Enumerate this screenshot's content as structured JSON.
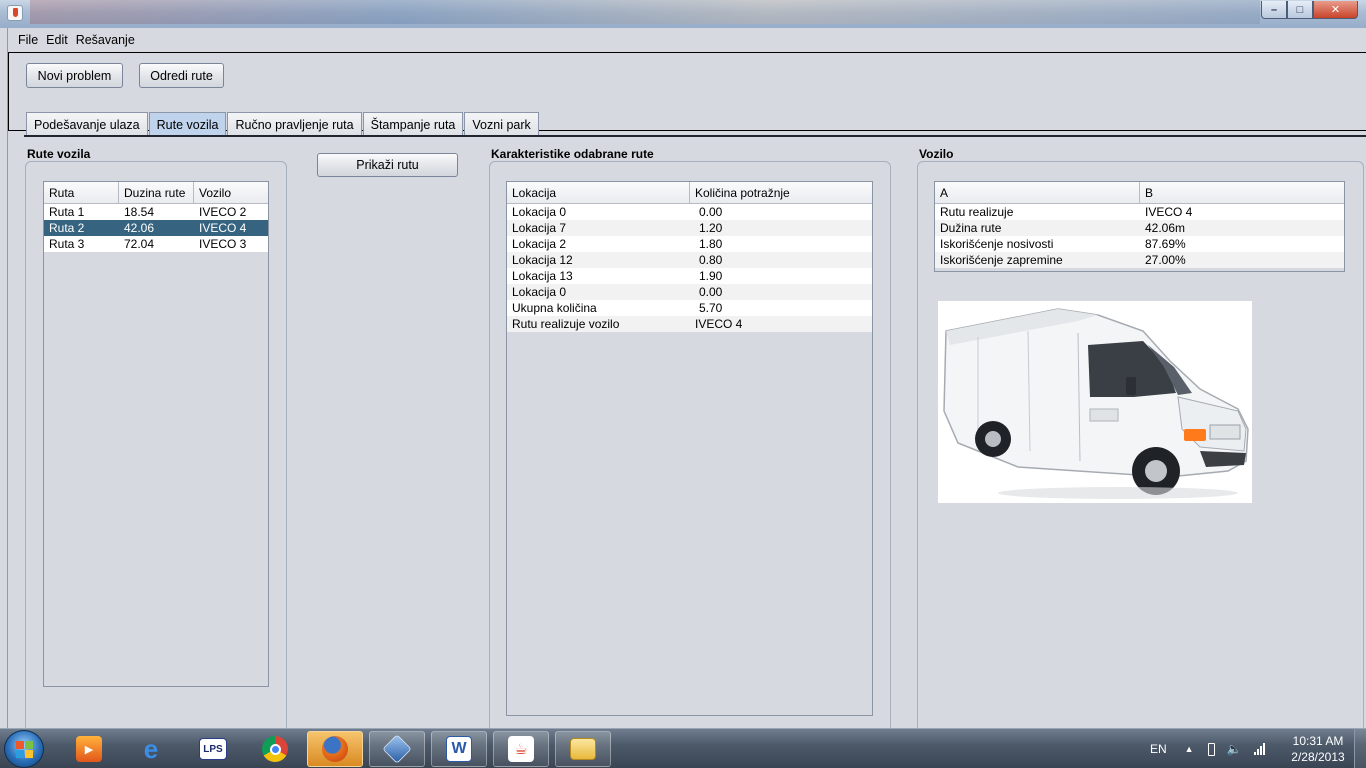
{
  "menu": [
    "File",
    "Edit",
    "Rešavanje"
  ],
  "toolbar": {
    "novi_problem": "Novi problem",
    "odredi_rute": "Odredi rute"
  },
  "tabs": [
    {
      "label": "Podešavanje ulaza"
    },
    {
      "label": "Rute vozila",
      "active": true
    },
    {
      "label": "Ručno pravljenje ruta"
    },
    {
      "label": "Štampanje ruta"
    },
    {
      "label": "Vozni park"
    }
  ],
  "rute_vozila": {
    "title": "Rute vozila",
    "headers": [
      "Ruta",
      "Duzina rute",
      "Vozilo"
    ],
    "rows": [
      {
        "ruta": "Ruta 1",
        "duzina": "18.54",
        "vozilo": "IVECO 2"
      },
      {
        "ruta": "Ruta 2",
        "duzina": "42.06",
        "vozilo": "IVECO 4",
        "selected": true
      },
      {
        "ruta": "Ruta 3",
        "duzina": "72.04",
        "vozilo": "IVECO 3"
      }
    ]
  },
  "prikazi_rutu": "Prikaži rutu",
  "karakteristike": {
    "title": "Karakteristike odabrane rute",
    "headers": [
      "Lokacija",
      "Količina potražnje"
    ],
    "rows": [
      {
        "lokacija": "Lokacija 0",
        "kolicina": "0.00"
      },
      {
        "lokacija": "Lokacija 7",
        "kolicina": "1.20"
      },
      {
        "lokacija": "Lokacija 2",
        "kolicina": "1.80"
      },
      {
        "lokacija": "Lokacija 12",
        "kolicina": "0.80"
      },
      {
        "lokacija": "Lokacija 13",
        "kolicina": "1.90"
      },
      {
        "lokacija": "Lokacija 0",
        "kolicina": "0.00"
      },
      {
        "lokacija": "Ukupna količina",
        "kolicina": "5.70"
      },
      {
        "lokacija": "Rutu realizuje vozilo",
        "kolicina": "IVECO 4"
      }
    ]
  },
  "vozilo": {
    "title": "Vozilo",
    "headers": [
      "A",
      "B"
    ],
    "rows": [
      {
        "a": "Rutu realizuje",
        "b": "IVECO 4"
      },
      {
        "a": "Dužina rute",
        "b": "42.06m"
      },
      {
        "a": "Iskorišćenje nosivosti",
        "b": "87.69%"
      },
      {
        "a": "Iskorišćenje zapremine",
        "b": "27.00%"
      }
    ],
    "image": "white-van-image"
  },
  "taskbar": {
    "apps": [
      "media-player-icon",
      "internet-explorer-icon",
      "lps-icon",
      "chrome-icon",
      "firefox-icon",
      "virtualbox-icon",
      "word-icon",
      "java-icon",
      "folder-icon"
    ],
    "lps_label": "LPS",
    "lang": "EN",
    "time": "10:31 AM",
    "date": "2/28/2013"
  }
}
